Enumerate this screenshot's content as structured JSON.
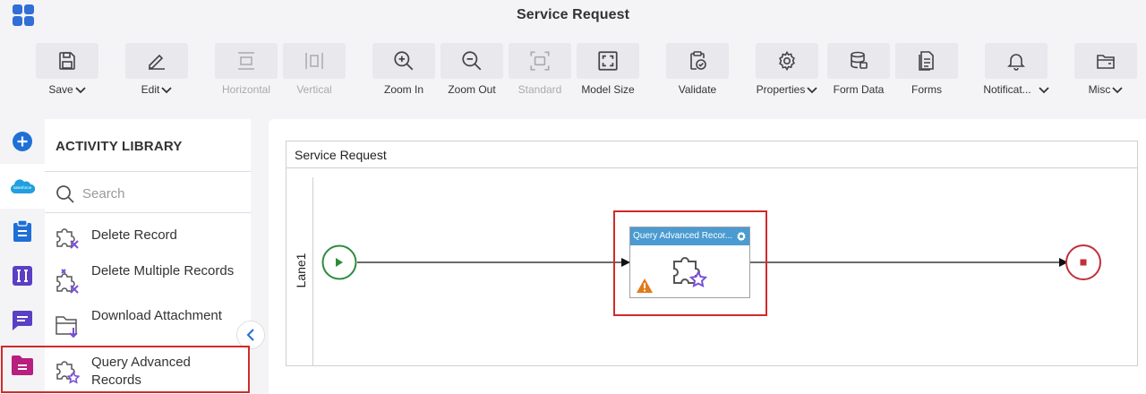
{
  "app": {
    "title": "Service Request"
  },
  "toolbar": {
    "save": "Save",
    "edit": "Edit",
    "horizontal": "Horizontal",
    "vertical": "Vertical",
    "zoom_in": "Zoom In",
    "zoom_out": "Zoom Out",
    "standard": "Standard",
    "model_size": "Model Size",
    "validate": "Validate",
    "properties": "Properties",
    "form_data": "Form Data",
    "forms": "Forms",
    "notifications": "Notificat...",
    "misc": "Misc"
  },
  "library": {
    "title": "ACTIVITY LIBRARY",
    "search_placeholder": "Search",
    "items": [
      {
        "label": "Delete Record",
        "icon": "puzzle-delete-icon"
      },
      {
        "label": "Delete Multiple Records",
        "icon": "puzzle-delete-multiple-icon"
      },
      {
        "label": "Download Attachment",
        "icon": "download-attachment-icon"
      },
      {
        "label": "Query Advanced Records",
        "icon": "puzzle-star-icon"
      }
    ]
  },
  "diagram": {
    "pool_title": "Service Request",
    "lane_label": "Lane1",
    "task_title": "Query Advanced Recor..."
  },
  "colors": {
    "accent": "#4a9bd1",
    "highlight": "#d12a2a",
    "start": "#2e8b3e",
    "end": "#c0303a",
    "warning": "#e07b1a",
    "purple": "#7b4fd6"
  }
}
